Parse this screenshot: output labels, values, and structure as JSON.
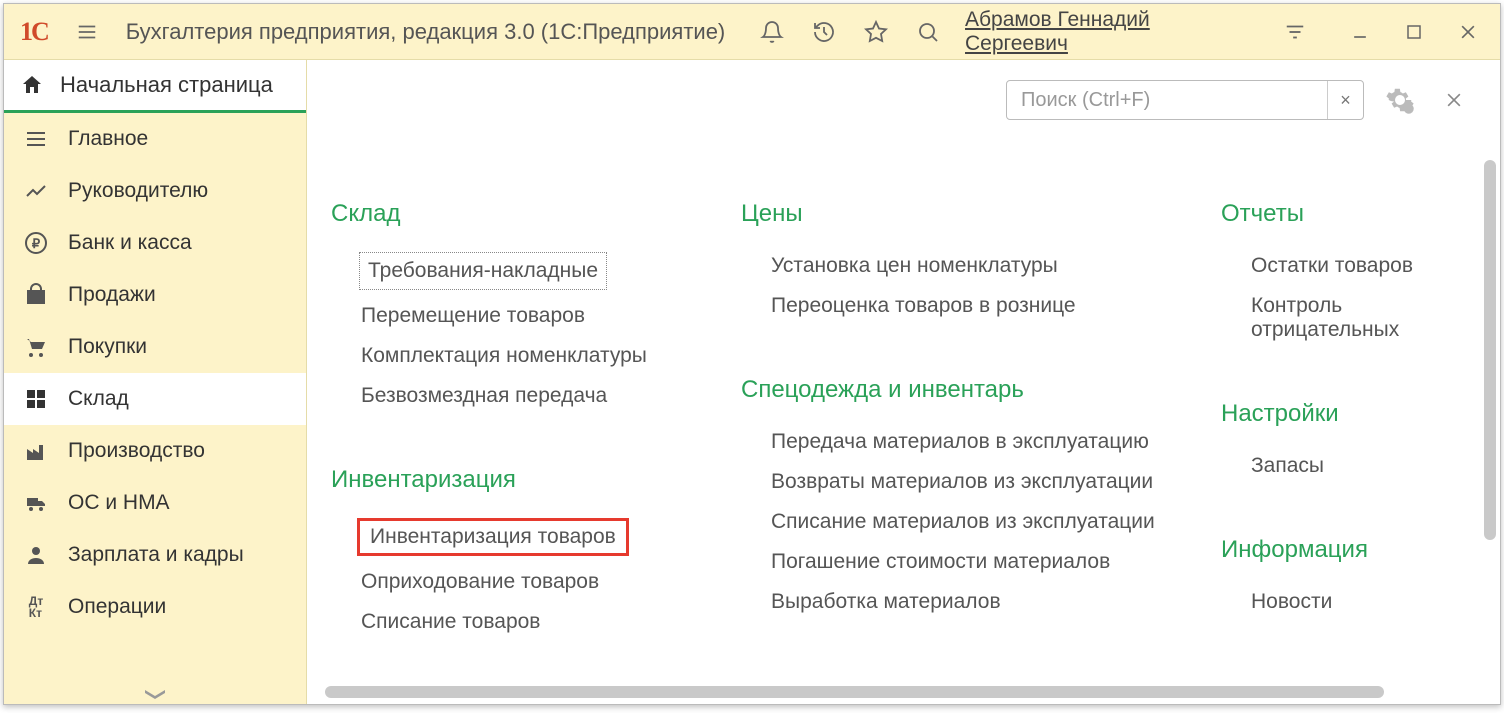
{
  "titlebar": {
    "title": "Бухгалтерия предприятия, редакция 3.0  (1С:Предприятие)",
    "user": "Абрамов Геннадий Сергеевич"
  },
  "sidebar": {
    "home": "Начальная страница",
    "items": [
      {
        "label": "Главное",
        "icon": "menu"
      },
      {
        "label": "Руководителю",
        "icon": "chart"
      },
      {
        "label": "Банк и касса",
        "icon": "ruble"
      },
      {
        "label": "Продажи",
        "icon": "bag"
      },
      {
        "label": "Покупки",
        "icon": "cart"
      },
      {
        "label": "Склад",
        "icon": "grid",
        "active": true
      },
      {
        "label": "Производство",
        "icon": "factory"
      },
      {
        "label": "ОС и НМА",
        "icon": "truck"
      },
      {
        "label": "Зарплата и кадры",
        "icon": "person"
      },
      {
        "label": "Операции",
        "icon": "dtkt"
      }
    ]
  },
  "content": {
    "search_placeholder": "Поиск (Ctrl+F)",
    "columns": [
      {
        "sections": [
          {
            "title": "Склад",
            "items": [
              {
                "label": "Требования-накладные",
                "dotted": true
              },
              {
                "label": "Перемещение товаров"
              },
              {
                "label": "Комплектация номенклатуры"
              },
              {
                "label": "Безвозмездная передача"
              }
            ]
          },
          {
            "title": "Инвентаризация",
            "items": [
              {
                "label": "Инвентаризация товаров",
                "highlighted": true
              },
              {
                "label": "Оприходование товаров"
              },
              {
                "label": "Списание товаров"
              }
            ]
          }
        ]
      },
      {
        "sections": [
          {
            "title": "Цены",
            "items": [
              {
                "label": "Установка цен номенклатуры"
              },
              {
                "label": "Переоценка товаров в рознице"
              }
            ]
          },
          {
            "title": "Спецодежда и инвентарь",
            "items": [
              {
                "label": "Передача материалов в эксплуатацию"
              },
              {
                "label": "Возвраты материалов из эксплуатации"
              },
              {
                "label": "Списание материалов из эксплуатации"
              },
              {
                "label": "Погашение стоимости материалов"
              },
              {
                "label": "Выработка материалов"
              }
            ]
          }
        ]
      },
      {
        "sections": [
          {
            "title": "Отчеты",
            "items": [
              {
                "label": "Остатки товаров"
              },
              {
                "label": "Контроль отрицательных"
              }
            ]
          },
          {
            "title": "Настройки",
            "items": [
              {
                "label": "Запасы"
              }
            ]
          },
          {
            "title": "Информация",
            "items": [
              {
                "label": "Новости"
              }
            ]
          }
        ]
      }
    ]
  }
}
